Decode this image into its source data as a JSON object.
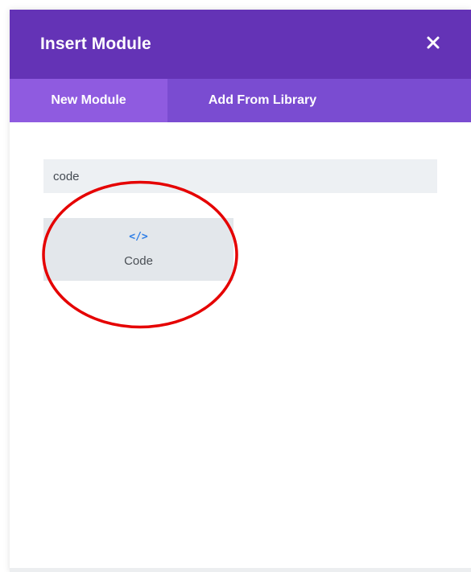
{
  "modal": {
    "title": "Insert Module",
    "close_icon": "close-icon"
  },
  "tabs": [
    {
      "label": "New Module",
      "active": true
    },
    {
      "label": "Add From Library",
      "active": false
    }
  ],
  "search": {
    "value": "code"
  },
  "modules": [
    {
      "icon": "code-icon",
      "icon_glyph": "</>",
      "label": "Code"
    }
  ],
  "colors": {
    "header": "#6433b6",
    "tab_bar": "#7a4cd1",
    "active_tab": "#8f5be0",
    "search_bg": "#edf0f3",
    "module_bg": "#e3e7eb",
    "icon_blue": "#2e7ee6",
    "highlight_ring": "#e50000"
  }
}
